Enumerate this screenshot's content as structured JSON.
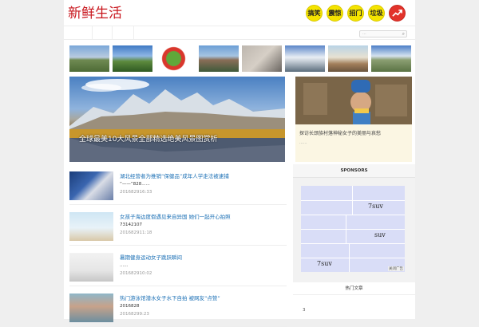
{
  "header": {
    "logo_text": "新鲜生活",
    "badges": [
      {
        "label": "搞笑",
        "color": "#f5e400"
      },
      {
        "label": "震惊",
        "color": "#f5e400"
      },
      {
        "label": "招门",
        "color": "#f5e400"
      },
      {
        "label": "垃圾",
        "color": "#f5e400"
      },
      {
        "label": "",
        "icon": "trending-icon",
        "color": "#e2332b"
      }
    ]
  },
  "search": {
    "placeholder": "..."
  },
  "hero": {
    "caption": "全球最美10大风景全部精选绝美风景图赏析"
  },
  "feature": {
    "title": "探访长颈族村落神秘女子的美丽与哀愁",
    "more": "......"
  },
  "articles": [
    {
      "title": "湖北经营者为推销“保健品”成年人学走法被逮捕",
      "excerpt": "“——”828......",
      "date": "201682916:33"
    },
    {
      "title": "女孩子海边度假遇见来自异国 她们一起开心拍照",
      "excerpt": "73142107",
      "date": "201682911:18"
    },
    {
      "title": "暑期健身运动女子跳跃瞬间",
      "excerpt": "......",
      "date": "201682910:02"
    },
    {
      "title": "热门游泳馆潜水女子水下自拍 被网友“点赞”",
      "excerpt": "2016828",
      "date": "20168299:23"
    }
  ],
  "sidebar": {
    "sponsors_title": "SPONSORS",
    "ad_texts": [
      "7suv",
      "suv",
      "7suv"
    ],
    "ad_close": "关闭广告",
    "block_title": "热门文章",
    "block_item": "3"
  },
  "colors": {
    "accent": "#c8161d",
    "link": "#1a6fb5",
    "badge": "#f5e400"
  }
}
